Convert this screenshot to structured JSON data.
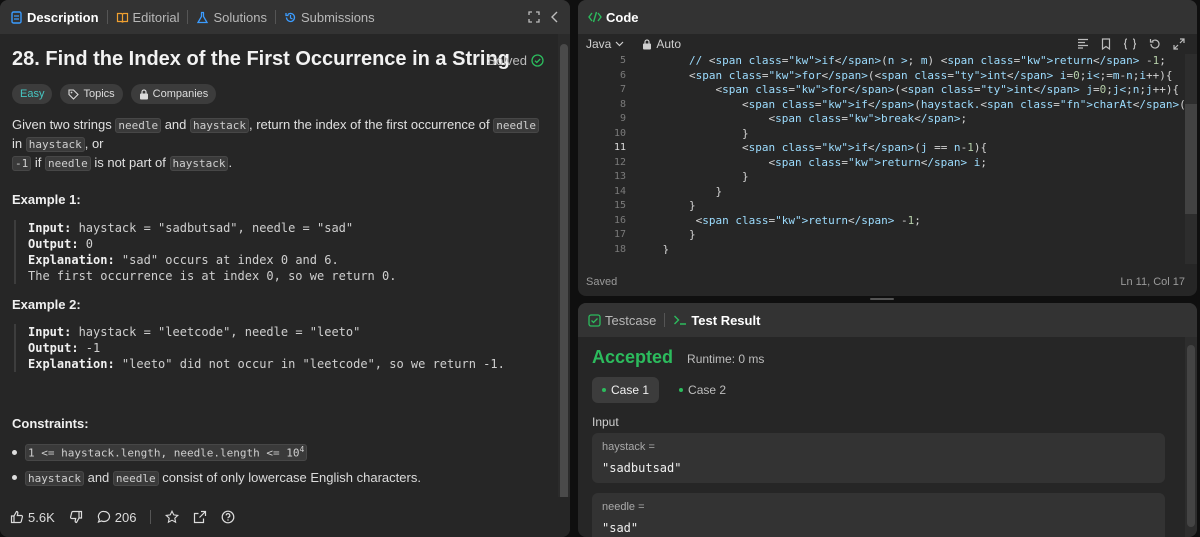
{
  "left_tabs": {
    "description": "Description",
    "editorial": "Editorial",
    "solutions": "Solutions",
    "submissions": "Submissions"
  },
  "problem": {
    "title": "28. Find the Index of the First Occurrence in a String",
    "status": "Solved",
    "difficulty": "Easy",
    "tags": [
      "Topics",
      "Companies"
    ],
    "desc": {
      "p1": "Given two strings ",
      "c1": "needle",
      "p2": " and ",
      "c2": "haystack",
      "p3": ", return the index of the first occurrence of ",
      "c3": "needle",
      "p4": " in ",
      "c4": "haystack",
      "p5": ", or ",
      "c5": "-1",
      "p6": " if ",
      "c6": "needle",
      "p7": " is not part of ",
      "c7": "haystack",
      "p8": "."
    },
    "example1": {
      "title": "Example 1:",
      "input_label": "Input:",
      "input": " haystack = \"sadbutsad\", needle = \"sad\"",
      "output_label": "Output:",
      "output": " 0",
      "expl_label": "Explanation:",
      "expl1": " \"sad\" occurs at index 0 and 6.",
      "expl2": "The first occurrence is at index 0, so we return 0."
    },
    "example2": {
      "title": "Example 2:",
      "input_label": "Input:",
      "input": " haystack = \"leetcode\", needle = \"leeto\"",
      "output_label": "Output:",
      "output": " -1",
      "expl_label": "Explanation:",
      "expl1": " \"leeto\" did not occur in \"leetcode\", so we return -1."
    },
    "constraints_title": "Constraints:",
    "constraint1_code": "1 <= haystack.length, needle.length <= 10",
    "constraint1_sup": "4",
    "constraint2": {
      "c1": "haystack",
      "p1": " and ",
      "c2": "needle",
      "p2": " consist of only lowercase English characters."
    }
  },
  "footer": {
    "likes": "5.6K",
    "comments": "206"
  },
  "code_panel": {
    "tab": "Code",
    "language": "Java",
    "mode": "Auto",
    "saved": "Saved",
    "cursor": "Ln 11, Col 17",
    "lines": [
      {
        "n": "5",
        "text": "        // if(n > m) return -1;"
      },
      {
        "n": "6",
        "text": "        for(int i=0;i<=m-n;i++){"
      },
      {
        "n": "7",
        "text": "            for(int j=0;j<n;j++){"
      },
      {
        "n": "8",
        "text": "                if(haystack.charAt(i+j) != needle.charAt(j)){"
      },
      {
        "n": "9",
        "text": "                    break;"
      },
      {
        "n": "10",
        "text": "                }"
      },
      {
        "n": "11",
        "text": "                if(j == n-1){"
      },
      {
        "n": "12",
        "text": "                    return i;"
      },
      {
        "n": "13",
        "text": "                }"
      },
      {
        "n": "14",
        "text": "            }"
      },
      {
        "n": "15",
        "text": "        }"
      },
      {
        "n": "16",
        "text": "         return -1;"
      },
      {
        "n": "17",
        "text": "        }"
      },
      {
        "n": "18",
        "text": "    }"
      }
    ]
  },
  "result_panel": {
    "testcase_tab": "Testcase",
    "result_tab": "Test Result",
    "status": "Accepted",
    "runtime": "Runtime: 0 ms",
    "case1": "Case 1",
    "case2": "Case 2",
    "input_label": "Input",
    "field1_name": "haystack =",
    "field1_value": "\"sadbutsad\"",
    "field2_name": "needle =",
    "field2_value": "\"sad\""
  },
  "colors": {
    "accepted": "#2cbb5d",
    "easy": "#46c6c2",
    "accent_blue": "#3b9cff"
  }
}
